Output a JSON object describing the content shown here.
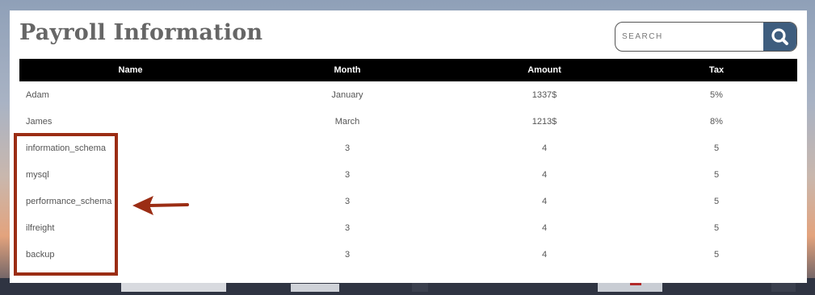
{
  "page": {
    "title": "Payroll Information"
  },
  "search": {
    "placeholder": "SEARCH",
    "button_icon": "search-icon"
  },
  "table": {
    "headers": [
      "Name",
      "Month",
      "Amount",
      "Tax"
    ],
    "rows": [
      [
        "Adam",
        "January",
        "1337$",
        "5%"
      ],
      [
        "James",
        "March",
        "1213$",
        "8%"
      ],
      [
        "information_schema",
        "3",
        "4",
        "5"
      ],
      [
        "mysql",
        "3",
        "4",
        "5"
      ],
      [
        "performance_schema",
        "3",
        "4",
        "5"
      ],
      [
        "ilfreight",
        "3",
        "4",
        "5"
      ],
      [
        "backup",
        "3",
        "4",
        "5"
      ]
    ]
  },
  "annotation": {
    "box_color": "#9b2d14",
    "arrow_icon": "left-arrow-icon",
    "arrow_color": "#9b2d14"
  },
  "colors": {
    "header_bg": "#000000",
    "search_button": "#3e5d7e",
    "title": "#666666"
  }
}
